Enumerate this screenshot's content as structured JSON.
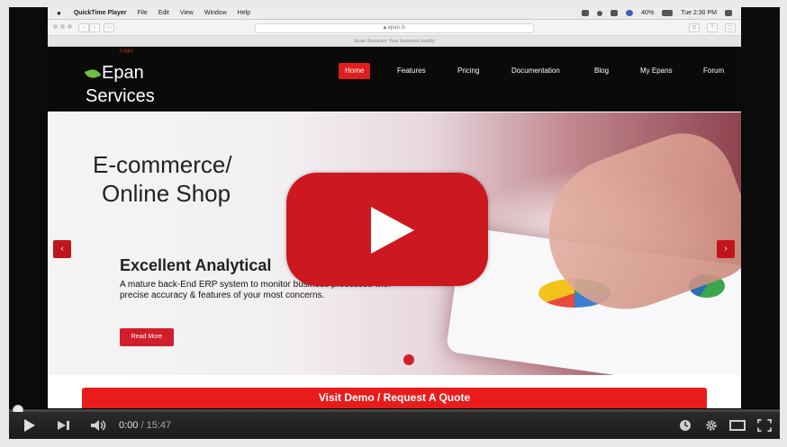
{
  "menubar": {
    "app_name": "QuickTime Player",
    "items": [
      "File",
      "Edit",
      "View",
      "Window",
      "Help"
    ],
    "battery": "40%",
    "clock": "Tue 2:30 PM"
  },
  "safari": {
    "url": "epan.in",
    "tab_title": "Epan Services: Your business buddy"
  },
  "site": {
    "login": "Login",
    "logo_line1": "Epan",
    "logo_line2": "Services",
    "nav": [
      "Home",
      "Features",
      "Pricing",
      "Documentation",
      "Blog",
      "My Epans",
      "Forum"
    ]
  },
  "hero": {
    "title_line1": "E-commerce/",
    "title_line2": "Online Shop",
    "subtitle": "Excellent Analytical",
    "description": "A mature back-End ERP system to monitor business processes with precise accuracy & features of your most concerns.",
    "read_more": "Read More",
    "prev_glyph": "‹",
    "next_glyph": "›"
  },
  "quote_bar": "Visit Demo / Request A Quote",
  "player": {
    "current_time": "0:00",
    "separator": "/",
    "duration": "15:47",
    "progress": 0
  },
  "colors": {
    "brand_red": "#e01e1e",
    "youtube_red": "#cc181e",
    "controls_bg": "#1b1b1b"
  },
  "icons": [
    "play-icon",
    "next-icon",
    "volume-icon",
    "watch-later-icon",
    "settings-icon",
    "theater-icon",
    "fullscreen-icon",
    "big-play-icon"
  ]
}
